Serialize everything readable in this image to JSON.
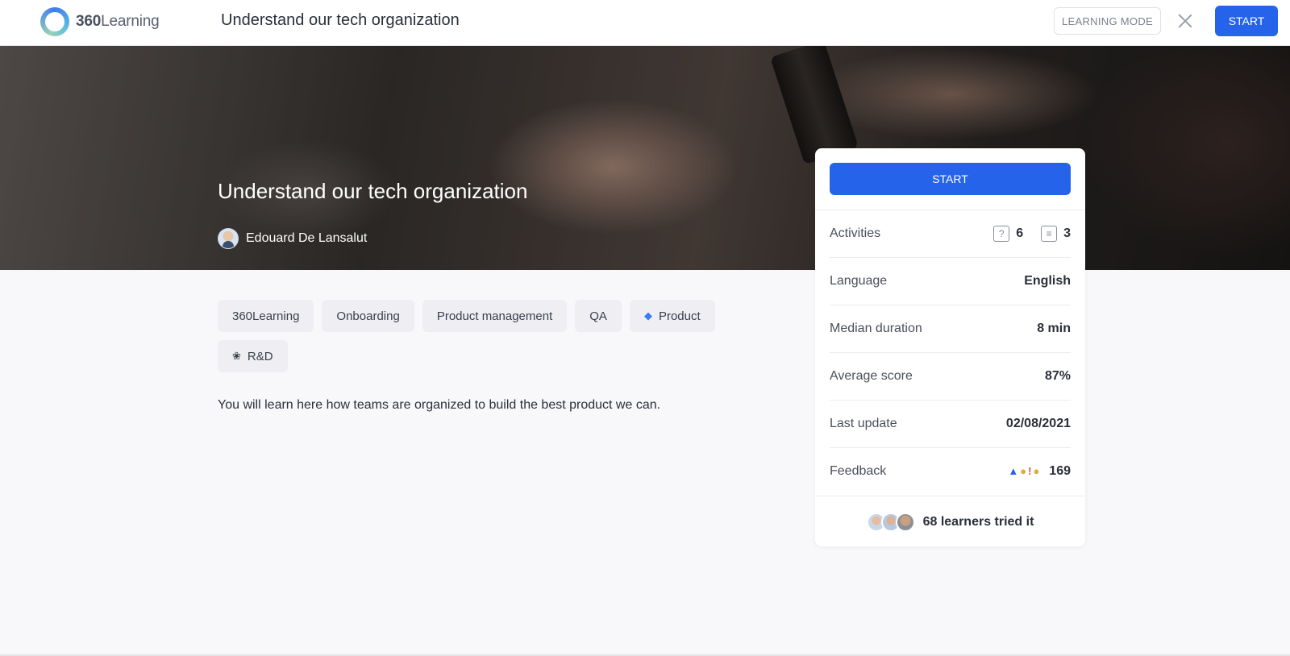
{
  "header": {
    "logo_text_bold": "360",
    "logo_text": "Learning",
    "title": "Understand our tech organization",
    "mode_button": "LEARNING MODE",
    "start_button": "START"
  },
  "hero": {
    "title": "Understand our tech organization",
    "author": "Edouard De Lansalut"
  },
  "tags": [
    {
      "label": "360Learning",
      "icon": ""
    },
    {
      "label": "Onboarding",
      "icon": ""
    },
    {
      "label": "Product management",
      "icon": ""
    },
    {
      "label": "QA",
      "icon": ""
    },
    {
      "label": "Product",
      "icon": "gem-icon"
    },
    {
      "label": "R&D",
      "icon": "brain-icon"
    }
  ],
  "description": "You will learn here how teams are organized to build the best product we can.",
  "card": {
    "start_button": "START",
    "activities_label": "Activities",
    "activities_questions": "6",
    "activities_docs": "3",
    "language_label": "Language",
    "language_value": "English",
    "duration_label": "Median duration",
    "duration_value": "8 min",
    "score_label": "Average score",
    "score_value": "87%",
    "update_label": "Last update",
    "update_value": "02/08/2021",
    "feedback_label": "Feedback",
    "feedback_value": "169",
    "learners_text": "68 learners tried it"
  },
  "colors": {
    "accent": "#2563eb"
  }
}
